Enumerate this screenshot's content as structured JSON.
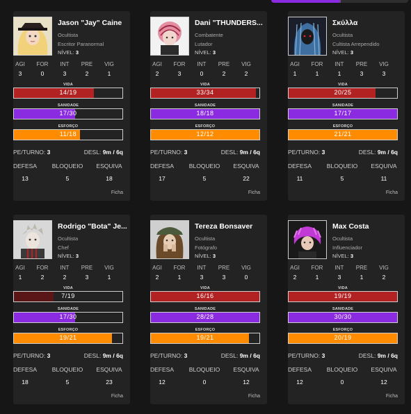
{
  "colors": {
    "vida": "#b22222",
    "vida_low": "#5a1616",
    "sanidade": "#8a2be2",
    "esforco": "#ff8c00"
  },
  "labels": {
    "attrs": [
      "AGI",
      "FOR",
      "INT",
      "PRE",
      "VIG"
    ],
    "vida": "VIDA",
    "sanidade": "SANIDADE",
    "esforco": "ESFORÇO",
    "pe": "PE/TURNO:",
    "desl": "DESL:",
    "defesa": "DEFESA",
    "bloqueio": "BLOQUEIO",
    "esquiva": "ESQUIVA",
    "ficha": "Ficha",
    "nivel": "NÍVEL:"
  },
  "characters": [
    {
      "name": "Jason \"Jay\" Caine",
      "class": "Ocultista",
      "origin": "Escritor Paranormal",
      "level": "3",
      "attrs": [
        "3",
        "0",
        "3",
        "2",
        "1"
      ],
      "vida": {
        "cur": 14,
        "max": 19,
        "text": "14/19"
      },
      "sanidade": {
        "cur": 17,
        "max": 30,
        "text": "17/30"
      },
      "esforco": {
        "cur": 11,
        "max": 18,
        "text": "11/18"
      },
      "pe": "3",
      "desl": "9m / 6q",
      "defesa": "13",
      "bloqueio": "5",
      "esquiva": "18",
      "portrait": "blonde-hat-portrait"
    },
    {
      "name": "Dani \"THUNDERS...",
      "class": "Combatente",
      "origin": "Lutador",
      "level": "3",
      "attrs": [
        "2",
        "3",
        "0",
        "2",
        "2"
      ],
      "vida": {
        "cur": 33,
        "max": 34,
        "text": "33/34"
      },
      "sanidade": {
        "cur": 18,
        "max": 18,
        "text": "18/18"
      },
      "esforco": {
        "cur": 12,
        "max": 12,
        "text": "12/12"
      },
      "pe": "3",
      "desl": "9m / 6q",
      "defesa": "17",
      "bloqueio": "5",
      "esquiva": "22",
      "portrait": "pink-braids-portrait"
    },
    {
      "name": "Σκύλλα",
      "class": "Ocultista",
      "origin": "Cultista Arrependido",
      "level": "3",
      "attrs": [
        "1",
        "1",
        "1",
        "3",
        "3"
      ],
      "vida": {
        "cur": 20,
        "max": 25,
        "text": "20/25"
      },
      "sanidade": {
        "cur": 17,
        "max": 17,
        "text": "17/17"
      },
      "esforco": {
        "cur": 21,
        "max": 21,
        "text": "21/21"
      },
      "pe": "3",
      "desl": "9m / 6q",
      "defesa": "11",
      "bloqueio": "5",
      "esquiva": "11",
      "portrait": "blue-hair-portrait"
    },
    {
      "name": "Rodrigo \"Bota\" Je...",
      "class": "Ocultista",
      "origin": "Chef",
      "level": "3",
      "attrs": [
        "1",
        "2",
        "2",
        "3",
        "1"
      ],
      "vida": {
        "cur": 7,
        "max": 19,
        "text": "7/19"
      },
      "sanidade": {
        "cur": 17,
        "max": 30,
        "text": "17/30"
      },
      "esforco": {
        "cur": 19,
        "max": 21,
        "text": "19/21"
      },
      "pe": "3",
      "desl": "9m / 6q",
      "defesa": "18",
      "bloqueio": "5",
      "esquiva": "23",
      "portrait": "pale-chef-portrait"
    },
    {
      "name": "Tereza Bonsaver",
      "class": "Ocultista",
      "origin": "Fotógrafo",
      "level": "3",
      "attrs": [
        "2",
        "1",
        "3",
        "3",
        "0"
      ],
      "vida": {
        "cur": 16,
        "max": 16,
        "text": "16/16"
      },
      "sanidade": {
        "cur": 28,
        "max": 28,
        "text": "28/28"
      },
      "esforco": {
        "cur": 19,
        "max": 21,
        "text": "19/21"
      },
      "pe": "3",
      "desl": "9m / 6q",
      "defesa": "12",
      "bloqueio": "0",
      "esquiva": "12",
      "portrait": "green-cap-portrait"
    },
    {
      "name": "Max Costa",
      "class": "Ocultista",
      "origin": "Influenciador",
      "level": "3",
      "attrs": [
        "2",
        "1",
        "3",
        "1",
        "2"
      ],
      "vida": {
        "cur": 19,
        "max": 19,
        "text": "19/19"
      },
      "sanidade": {
        "cur": 30,
        "max": 30,
        "text": "30/30"
      },
      "esforco": {
        "cur": 20,
        "max": 19,
        "text": "20/19"
      },
      "pe": "3",
      "desl": "9m / 6q",
      "defesa": "12",
      "bloqueio": "0",
      "esquiva": "12",
      "portrait": "purple-hair-portrait"
    }
  ]
}
